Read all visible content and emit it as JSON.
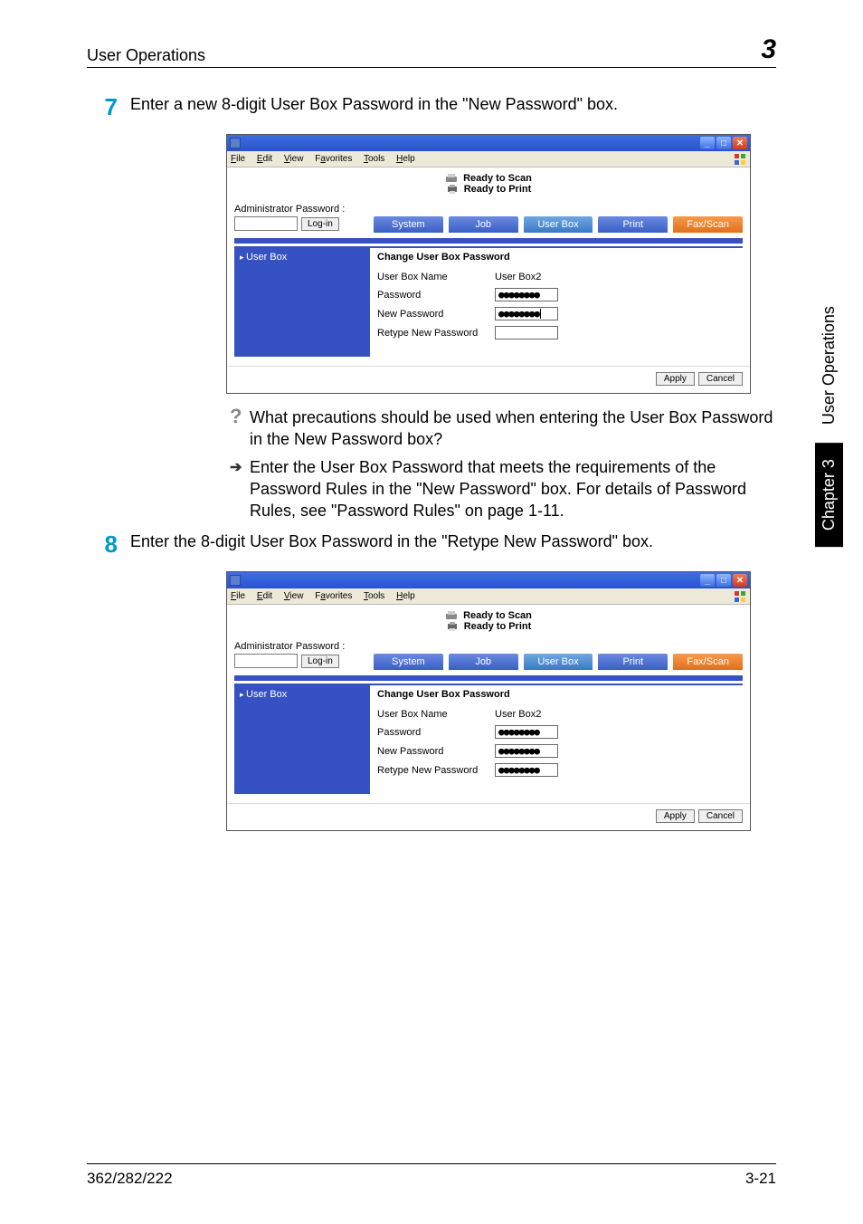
{
  "header": {
    "title": "User Operations",
    "chapter_number": "3"
  },
  "steps": {
    "s7": {
      "num": "7",
      "text": "Enter a new 8-digit User Box Password in the \"New Password\" box."
    },
    "s8": {
      "num": "8",
      "text": "Enter the 8-digit User Box Password in the \"Retype New Password\" box."
    }
  },
  "qa": {
    "question": "What precautions should be used when entering the User Box Password in the New Password box?",
    "answer": "Enter the User Box Password that meets the requirements of the Password Rules in the \"New Password\" box. For details of Password Rules, see \"Password Rules\" on page 1-11."
  },
  "browser": {
    "menus": {
      "file": "File",
      "edit": "Edit",
      "view": "View",
      "favorites": "Favorites",
      "tools": "Tools",
      "help": "Help"
    },
    "status": {
      "scan": "Ready to Scan",
      "print": "Ready to Print"
    },
    "admin": {
      "label": "Administrator Password :",
      "login": "Log-in"
    },
    "tabs": {
      "system": "System",
      "job": "Job",
      "userbox": "User Box",
      "print": "Print",
      "faxscan": "Fax/Scan"
    },
    "sidebar": {
      "userbox": "User Box"
    },
    "form": {
      "title": "Change User Box Password",
      "name_label": "User Box Name",
      "name_value": "User Box2",
      "pw_label": "Password",
      "newpw_label": "New Password",
      "retype_label": "Retype New Password",
      "mask8": "●●●●●●●●"
    },
    "buttons": {
      "apply": "Apply",
      "cancel": "Cancel"
    }
  },
  "sidetab": {
    "chapter": "Chapter 3",
    "title": "User Operations"
  },
  "footer": {
    "left": "362/282/222",
    "right": "3-21"
  }
}
